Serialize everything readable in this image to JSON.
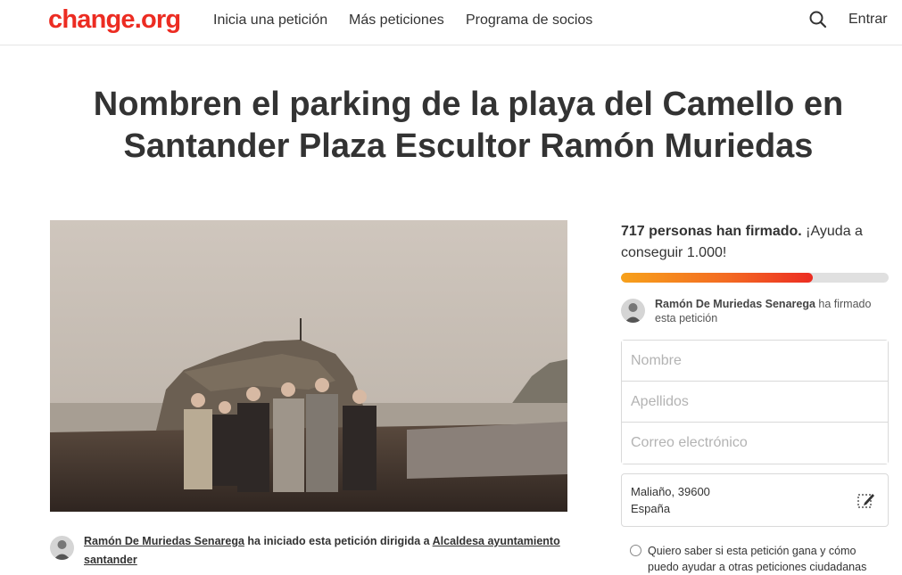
{
  "nav": {
    "logo": "change.org",
    "links": [
      "Inicia una petición",
      "Más peticiones",
      "Programa de socios"
    ],
    "search_icon": "search-icon",
    "login": "Entrar"
  },
  "petition": {
    "title": "Nombren el parking de la playa del Camello en Santander Plaza Escultor Ramón Muriedas",
    "starter_name": "Ramón De Muriedas Senarega",
    "starter_text": " ha iniciado esta petición dirigida a ",
    "target": "Alcaldesa ayuntamiento santander"
  },
  "sidebar": {
    "count_bold": "717 personas han firmado.",
    "count_rest": " ¡Ayuda a conseguir 1.000!",
    "signed": 717,
    "goal": 1000,
    "recent_signer_name": "Ramón De Muriedas Senarega",
    "recent_signer_text": " ha firmado esta petición",
    "form": {
      "first_name_placeholder": "Nombre",
      "last_name_placeholder": "Apellidos",
      "email_placeholder": "Correo electrónico"
    },
    "location_line1": "Maliaño, 39600",
    "location_line2": "España",
    "optin_text": "Quiero saber si esta petición gana y cómo puedo ayudar a otras peticiones ciudadanas"
  },
  "colors": {
    "brand": "#ec2c22",
    "progress_start": "#f7a11b",
    "progress_end": "#ec2c22"
  }
}
